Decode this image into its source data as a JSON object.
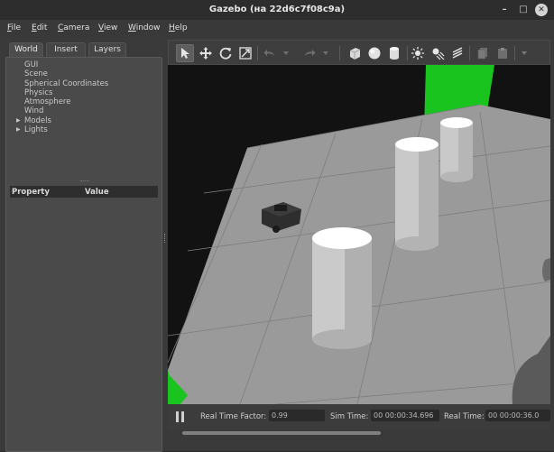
{
  "window": {
    "title": "Gazebo (на 22d6c7f08c9a)"
  },
  "menu": [
    {
      "label": "File",
      "key": "F",
      "rest": "ile"
    },
    {
      "label": "Edit",
      "key": "E",
      "rest": "dit"
    },
    {
      "label": "Camera",
      "key": "C",
      "rest": "amera"
    },
    {
      "label": "View",
      "key": "V",
      "rest": "iew"
    },
    {
      "label": "Window",
      "key": "W",
      "rest": "indow"
    },
    {
      "label": "Help",
      "key": "H",
      "rest": "elp"
    }
  ],
  "tabs": [
    "World",
    "Insert",
    "Layers"
  ],
  "tree": [
    {
      "label": "GUI",
      "expandable": false
    },
    {
      "label": "Scene",
      "expandable": false
    },
    {
      "label": "Spherical Coordinates",
      "expandable": false
    },
    {
      "label": "Physics",
      "expandable": false
    },
    {
      "label": "Atmosphere",
      "expandable": false
    },
    {
      "label": "Wind",
      "expandable": false
    },
    {
      "label": "Models",
      "expandable": true
    },
    {
      "label": "Lights",
      "expandable": true
    }
  ],
  "properties": {
    "col1": "Property",
    "col2": "Value"
  },
  "toolbar": {
    "tools": [
      "select-arrow-icon",
      "translate-icon",
      "rotate-icon",
      "scale-icon",
      "undo-icon",
      "redo-icon",
      "box-icon",
      "sphere-icon",
      "cylinder-icon",
      "point-light-icon",
      "spot-light-icon",
      "directional-light-icon",
      "copy-icon",
      "paste-icon"
    ]
  },
  "status": {
    "real_time_factor_label": "Real Time Factor:",
    "real_time_factor": "0.99",
    "sim_time_label": "Sim Time:",
    "sim_time": "00 00:00:34.696",
    "real_time_label": "Real Time:",
    "real_time": "00 00:00:36.0"
  },
  "colors": {
    "ground": "#9a9a9a",
    "green_wall": "#19c41e",
    "background": "#121212"
  }
}
